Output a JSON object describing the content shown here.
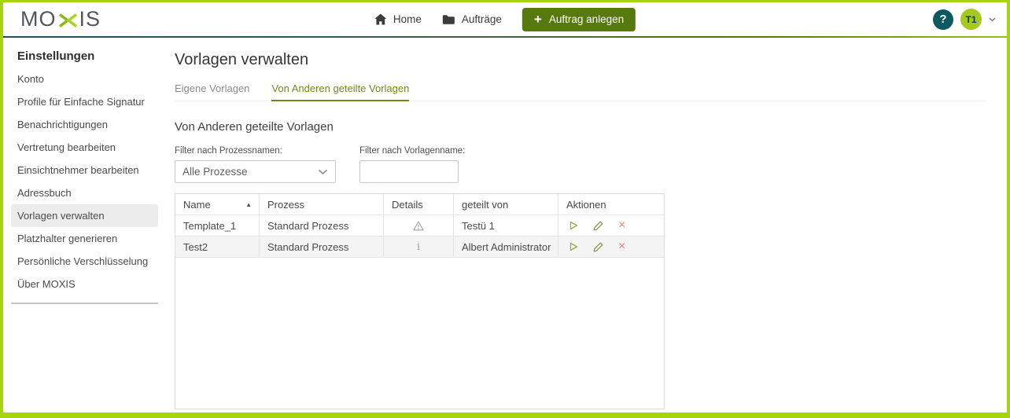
{
  "colors": {
    "lime_border": "#a6d40d",
    "olive_button": "#567a0d",
    "teal_help": "#0d5962",
    "avatar_bg": "#a5c91c",
    "active_tab": "#72871f",
    "delete_red": "#ec8074"
  },
  "topbar": {
    "logo_prefix": "MO",
    "logo_suffix": "IS",
    "nav": [
      {
        "label": "Home",
        "icon": "home-icon"
      },
      {
        "label": "Aufträge",
        "icon": "folder-icon"
      }
    ],
    "create_button_label": "Auftrag anlegen",
    "create_button_icon": "plus-icon",
    "help_label": "?",
    "avatar_label": "T1"
  },
  "sidebar": {
    "heading": "Einstellungen",
    "items": [
      {
        "label": "Konto",
        "active": false
      },
      {
        "label": "Profile für Einfache Signatur",
        "active": false
      },
      {
        "label": "Benachrichtigungen",
        "active": false
      },
      {
        "label": "Vertretung bearbeiten",
        "active": false
      },
      {
        "label": "Einsichtnehmer bearbeiten",
        "active": false
      },
      {
        "label": "Adressbuch",
        "active": false
      },
      {
        "label": "Vorlagen verwalten",
        "active": true
      },
      {
        "label": "Platzhalter generieren",
        "active": false
      },
      {
        "label": "Persönliche Verschlüsselung",
        "active": false
      },
      {
        "label": "Über MOXIS",
        "active": false
      }
    ]
  },
  "main": {
    "title": "Vorlagen verwalten",
    "tabs": [
      {
        "label": "Eigene Vorlagen",
        "active": false
      },
      {
        "label": "Von Anderen geteilte Vorlagen",
        "active": true
      }
    ],
    "section_title": "Von Anderen geteilte Vorlagen",
    "filters": {
      "process_filter_label": "Filter nach Prozessnamen:",
      "process_filter_value": "Alle Prozesse",
      "template_filter_label": "Filter nach Vorlagenname:",
      "template_filter_value": ""
    },
    "table": {
      "columns": [
        "Name",
        "Prozess",
        "Details",
        "geteilt von",
        "Aktionen"
      ],
      "sort_column": "Name",
      "sort_direction": "ascending",
      "rows": [
        {
          "name": "Template_1",
          "process": "Standard Prozess",
          "details_icon": "warning-icon",
          "shared_by": "Testü 1",
          "actions": [
            "start",
            "edit",
            "delete"
          ]
        },
        {
          "name": "Test2",
          "process": "Standard Prozess",
          "details_icon": "info-icon",
          "shared_by": "Albert Administrator",
          "actions": [
            "start",
            "edit",
            "delete"
          ]
        }
      ]
    }
  }
}
